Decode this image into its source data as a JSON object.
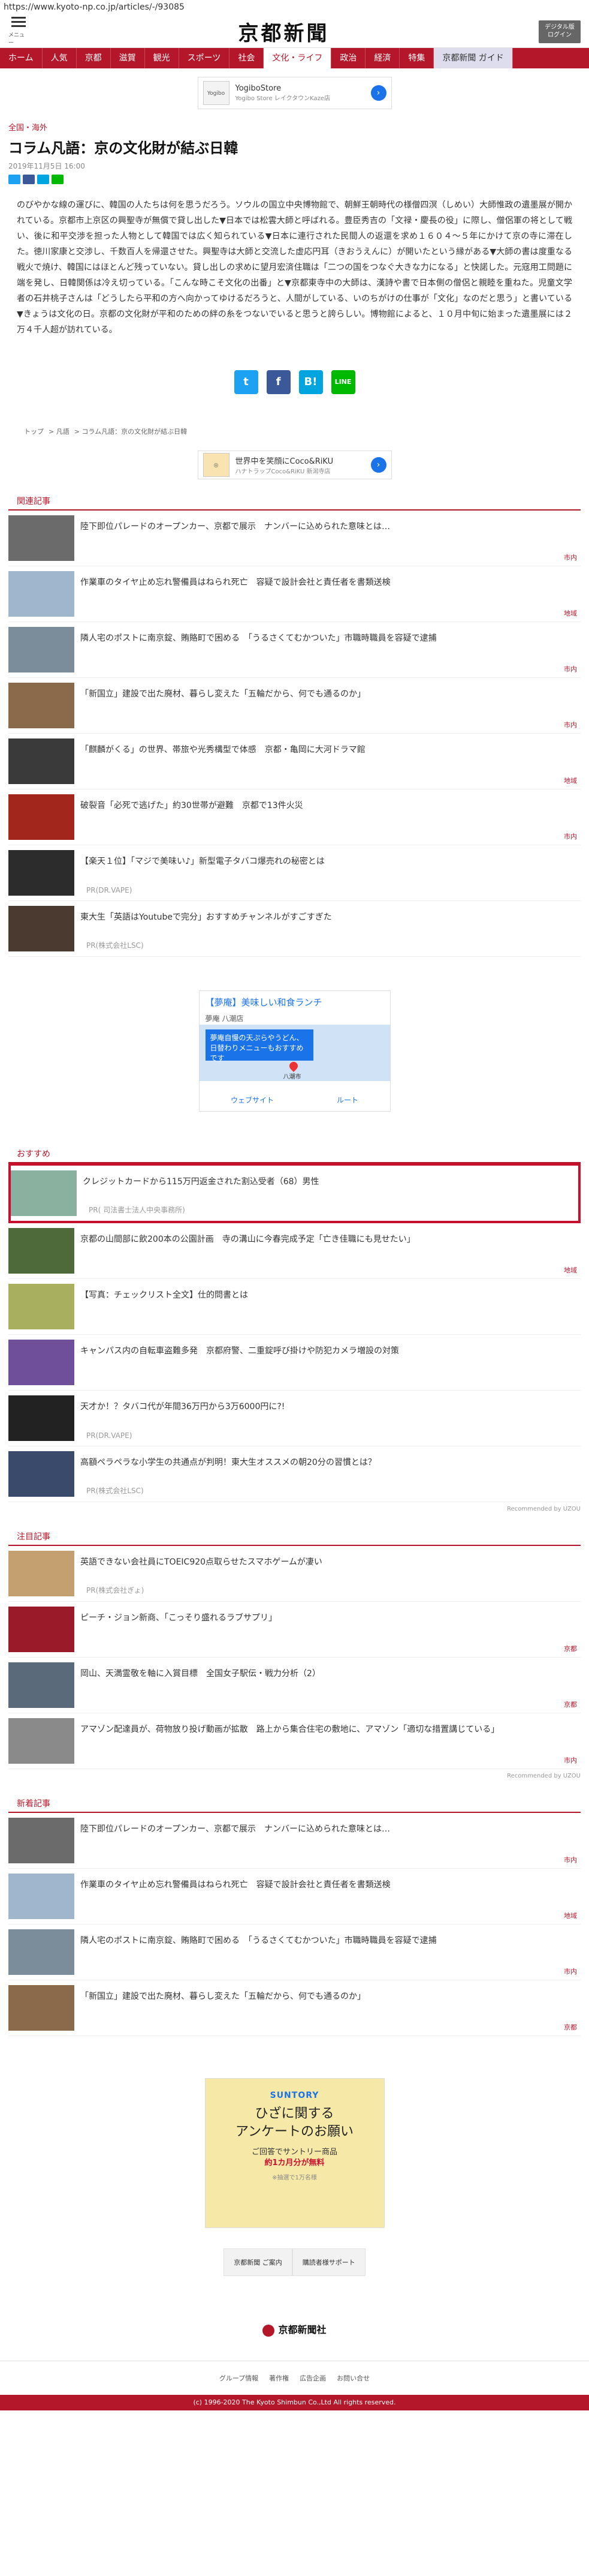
{
  "url": "https://www.kyoto-np.co.jp/articles/-/93085",
  "header": {
    "menu_caption": "メニュー",
    "logo": "京都新聞",
    "digital_button": "デジタル版\nログイン"
  },
  "nav": [
    "ホーム",
    "人気",
    "京都",
    "滋賀",
    "観光",
    "スポーツ",
    "社会",
    "文化・ライフ",
    "政治",
    "経済",
    "特集",
    "京都新聞 ガイド"
  ],
  "ad_top": {
    "logo": "Yogibo",
    "title": "YogiboStore",
    "sub": "Yogibo Store レイクタウンKaze店"
  },
  "article": {
    "category": "全国・海外",
    "title": "コラム凡語：京の文化財が結ぶ日韓",
    "date": "2019年11月5日 16:00",
    "body": "のびやかな線の運びに、韓国の人たちは何を思うだろう。ソウルの国立中央博物館で、朝鮮王朝時代の様僧四溟（しめい）大師惟政の遺墨展が開かれている。京都市上京区の興聖寺が無償で貸し出した▼日本では松雲大師と呼ばれる。豊臣秀吉の「文禄・慶長の役」に際し、僧侶軍の将として戦い、後に和平交渉を担った人物として韓国では広く知られている▼日本に連行された民間人の返還を求め１６０４～５年にかけて京の寺に滞在した。徳川家康と交渉し、千数百人を帰還させた。興聖寺は大師と交流した虚応円耳（きおうえんに）が開いたという縁がある▼大師の書は度重なる戦火で焼け、韓国にはほとんど残っていない。貸し出しの求めに望月宏済住職は「二つの国をつなぐ大きな力になる」と快諾した。元寇用工問題に端を発し、日韓関係は冷え切っている。「こんな時こそ文化の出番」と▼京都東寺中の大師は、漢詩や書で日本側の僧侶と親睦を重ねた。児童文学者の石井桃子さんは「どうしたら平和の方へ向かってゆけるだろうと、人間がしている、いのちがけの仕事が「文化」なのだと思う」と書いている▼きょうは文化の日。京都の文化財が平和のための絆の糸をつないでいると思うと誇らしい。博物館によると、１０月中旬に始まった遺墨展には２万４千人超が訪れている。"
  },
  "share_big": {
    "twitter": "t",
    "facebook": "f",
    "hatena": "B!",
    "line": "LINE"
  },
  "breadcrumb": [
    "トップ",
    "凡語",
    "コラム凡語：京の文化財が結ぶ日韓"
  ],
  "ad_mid": {
    "title": "世界中を笑顔にCoco&RiKU",
    "sub": "ハナトラップCoco&RiKU 新潟寺店"
  },
  "related": {
    "heading": "関連記事",
    "items": [
      {
        "title": "陸下即位パレードのオープンカー、京都で展示　ナンバーに込められた意味とは…",
        "tag": "市内",
        "color": "#6b6b6b"
      },
      {
        "title": "作業車のタイヤ止め忘れ警備員はねられ死亡　容疑で設計会社と責任者を書類送検",
        "tag": "地域",
        "color": "#9fb6cc"
      },
      {
        "title": "隣人宅のポストに南京錠、賄賂町で困める　「うるさくてむかついた」市職時職員を容疑で逮捕",
        "tag": "市内",
        "color": "#7b8c9a"
      },
      {
        "title": "「新国立」建設で出た廃材、暮らし変えた「五輪だから、何でも通るのか」",
        "tag": "市内",
        "color": "#8a6a4a"
      },
      {
        "title": "「麒麟がくる」の世界、帯旅や光秀構型で体感　京都・亀岡に大河ドラマ館",
        "tag": "地域",
        "color": "#3a3a3a"
      },
      {
        "title": "破裂音「必死で逃げた」約30世帯が避難　京都で13件火災",
        "tag": "市内",
        "color": "#a3261c"
      }
    ],
    "pr_items": [
      {
        "title": "【楽天１位】「マジで美味い♪」新型電子タバコ爆売れの秘密とは",
        "pr": "PR(DR.VAPE)",
        "color": "#2c2c2c"
      },
      {
        "title": "東大生「英語はYoutubeで完分」おすすめチャンネルがすごすぎた",
        "pr": "PR(株式会社LSC)",
        "color": "#4a3a30"
      }
    ]
  },
  "ad_map": {
    "title": "【夢庵】美味しい和食ランチ",
    "sub": "夢庵 八潮店",
    "callout": "夢庵自慢の天ぷらやうどん、日替わりメニューもおすすめです",
    "pin_label": "八潮市",
    "website": "ウェブサイト",
    "route": "ルート"
  },
  "osusume": {
    "heading": "おすすめ",
    "highlight": {
      "title": "クレジットカードから115万円返金された割込受者（68）男性",
      "pr": "PR( 司法書士法人中央事務所)",
      "color": "#8ab0a0"
    },
    "items": [
      {
        "title": "京都の山間部に飲200本の公園計画　寺の溝山に今春完成予定「亡き佳職にも見せたい」",
        "tag": "地域",
        "color": "#4f6a3a"
      },
      {
        "title": "【写真：チェックリスト全文】仕的問書とは",
        "tag": "",
        "color": "#a8b060"
      },
      {
        "title": "キャンパス内の自転車盗難多発　京都府警、二重錠呼び掛けや防犯カメラ増設の対策",
        "tag": "",
        "color": "#6f4f9a"
      },
      {
        "title": "天才か！？タバコ代が年間36万円から3万6000円に?!",
        "pr": "PR(DR.VAPE)",
        "color": "#222222"
      },
      {
        "title": "高額ペラペラな小学生の共通点が判明！東大生オススメの朝20分の習慣とは？",
        "pr": "PR(株式会社LSC)",
        "color": "#3a4a6a"
      }
    ],
    "recommended_by": "Recommended by UZOU"
  },
  "notice": {
    "heading": "注目記事",
    "items": [
      {
        "title": "英語できない会社員にTOEIC920点取らせたスマホゲームが凄い",
        "pr": "PR(株式会社ぎょ)",
        "color": "#c4a070"
      },
      {
        "title": "ピーチ・ジョン新商、「こっそり盛れるラブサプリ」",
        "tag": "京都",
        "color": "#9a1a2a"
      },
      {
        "title": "岡山、天満霊敬を軸に入賞目標　全国女子駅伝・戦力分析（2）",
        "tag": "京都",
        "color": "#5a6a7a"
      },
      {
        "title": "アマゾン配達員が、荷物放り投げ動画が拡散　路上から集合住宅の敷地に、アマゾン「適切な措置講じている」",
        "tag": "市内",
        "color": "#8a8a8a"
      }
    ],
    "recommended_by": "Recommended by UZOU"
  },
  "newest": {
    "heading": "新着記事",
    "items": [
      {
        "title": "陸下即位パレードのオープンカー、京都で展示　ナンバーに込められた意味とは…",
        "tag": "市内",
        "color": "#6b6b6b"
      },
      {
        "title": "作業車のタイヤ止め忘れ警備員はねられ死亡　容疑で設計会社と責任者を書類送検",
        "tag": "地域",
        "color": "#9fb6cc"
      },
      {
        "title": "隣人宅のポストに南京錠、賄賂町で困める　「うるさくてむかついた」市職時職員を容疑で逮捕",
        "tag": "市内",
        "color": "#7b8c9a"
      },
      {
        "title": "「新国立」建設で出た廃材、暮らし変えた「五輪だから、何でも通るのか」",
        "tag": "京都",
        "color": "#8a6a4a"
      }
    ]
  },
  "ad_suntory": {
    "brand": "SUNTORY",
    "main": "ひざに関する\nアンケートのお願い",
    "sub_line1": "ご回答でサントリー商品",
    "sub_line2": "約1カ月分が無料",
    "note": "※抽選で1万名様"
  },
  "footer_links": [
    "京都新聞 ご案内",
    "購読者様サポート"
  ],
  "footer_logo": "京都新聞社",
  "footer_nav": [
    "グループ情報",
    "著作権",
    "広告企画",
    "お問い合せ"
  ],
  "copyright": "(c) 1996-2020 The Kyoto Shimbun Co.,Ltd All rights reserved."
}
